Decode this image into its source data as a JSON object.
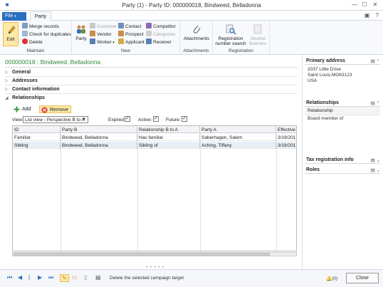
{
  "window": {
    "title": "Party (1) - Party ID: 000000018,  Bindweed, Belladonna",
    "controls": [
      "minimize-icon",
      "maximize-icon",
      "close-icon"
    ]
  },
  "tabs": {
    "file": "File",
    "party": "Party"
  },
  "ribbon": {
    "maintain": {
      "label": "Maintain",
      "edit": "Edit",
      "merge": "Merge records",
      "check_duplicates": "Check for duplicates",
      "delete": "Delete"
    },
    "new": {
      "label": "New",
      "party": "Party",
      "customer": "Customer",
      "vendor": "Vendor",
      "worker": "Worker",
      "contact": "Contact",
      "prospect": "Prospect",
      "applicant": "Applicant",
      "competitor": "Competitor",
      "categories": "Categories",
      "receiver": "Receiver"
    },
    "attachments": {
      "label": "Attachments",
      "button": "Attachments"
    },
    "registration": {
      "label": "Registration",
      "number_search": "Registration number search",
      "alcohol_licenses": "Alcohol licenses"
    }
  },
  "record": {
    "title": "000000018 :  Bindweed, Belladonna"
  },
  "fasttabs": {
    "general": "General",
    "addresses": "Addresses",
    "contact": "Contact information",
    "relationships": "Relationships"
  },
  "relationships": {
    "add": "Add",
    "remove": "Remove",
    "view_label": "View:",
    "view_value": "List view - Perspective B to A",
    "expired_label": "Expired:",
    "active_label": "Active:",
    "future_label": "Future:",
    "expired_checked": true,
    "active_checked": true,
    "future_checked": true,
    "columns": [
      "ID",
      "Party B",
      "Relationship B to A",
      "Party A",
      "Effective"
    ],
    "rows": [
      [
        "Familiar",
        "Bindweed, Belladonna",
        "Has familiar",
        "Saberhagen, Salem",
        "3/19/201"
      ],
      [
        "Sibling",
        "Bindweed, Belladonna",
        "Sibling of",
        "Aching, Tiffany",
        "3/19/201"
      ]
    ]
  },
  "factbox": {
    "primary_address": {
      "title": "Primary address",
      "line1": "2037 Little Drive",
      "line2": "Saint Louis,MO63123",
      "line3": "USA"
    },
    "relationships": {
      "title": "Relationships",
      "header": "Relationship",
      "item": "Board member of"
    },
    "tax": {
      "title": "Tax registration info"
    },
    "roles": {
      "title": "Roles"
    }
  },
  "status": {
    "message": "Delete the selected campaign target",
    "notifications": "(0)",
    "close": "Close"
  },
  "colors": {
    "accent": "#2a6fbe",
    "record_title": "#2e8b3a",
    "highlight": "#fde9a6"
  }
}
